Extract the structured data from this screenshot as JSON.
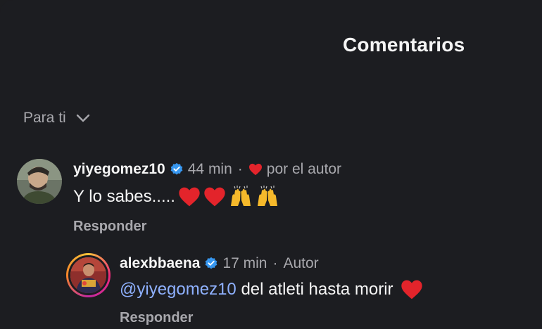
{
  "header": {
    "title": "Comentarios"
  },
  "sort": {
    "label": "Para ti",
    "icon": "chevron-down-icon"
  },
  "comments": [
    {
      "username": "yiyegomez10",
      "time": "44 min",
      "liked_label": "por el autor",
      "text": "Y lo sabes.....",
      "reply_label": "Responder"
    }
  ],
  "replies": [
    {
      "username": "alexbbaena",
      "time": "17 min",
      "author_label": "Autor",
      "mention": "@yiyegomez10",
      "text": " del atleti hasta morir",
      "reply_label": "Responder"
    }
  ],
  "colors": {
    "background": "#1c1d21",
    "mention": "#8fb1ff",
    "verified": "#3797f0",
    "heart": "#e3242b",
    "secondary": "#a8a8ad"
  }
}
